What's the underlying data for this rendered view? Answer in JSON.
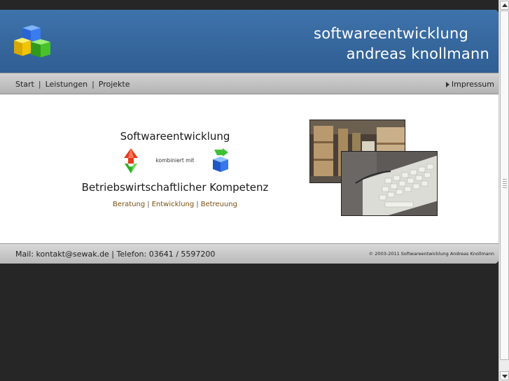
{
  "header": {
    "brand_line1": "softwareentwicklung",
    "brand_line2": "andreas knollmann",
    "logo_icon": "colored-cubes-icon"
  },
  "nav": {
    "links": [
      "Start",
      "Leistungen",
      "Projekte"
    ],
    "separator": "|",
    "impressum": "Impressum"
  },
  "main": {
    "headline1": "Softwareentwicklung",
    "combined_label": "kombiniert mit",
    "headline2": "Betriebswirtschaftlicher Kompetenz",
    "services": [
      "Beratung",
      "Entwicklung",
      "Betreuung"
    ],
    "services_separator": "|",
    "icons": [
      "red-green-arrows-icon",
      "blue-cube-icon"
    ],
    "photos": [
      "warehouse-photo",
      "keyboard-photo"
    ]
  },
  "footer": {
    "contact": "Mail: kontakt@sewak.de | Telefon: 03641 / 5597200",
    "copyright": "© 2003-2011 Softwareentwicklung Andreas Knollmann"
  },
  "colors": {
    "header_blue": "#3a6da4",
    "background": "#262626",
    "service_link": "#7a4f10"
  }
}
